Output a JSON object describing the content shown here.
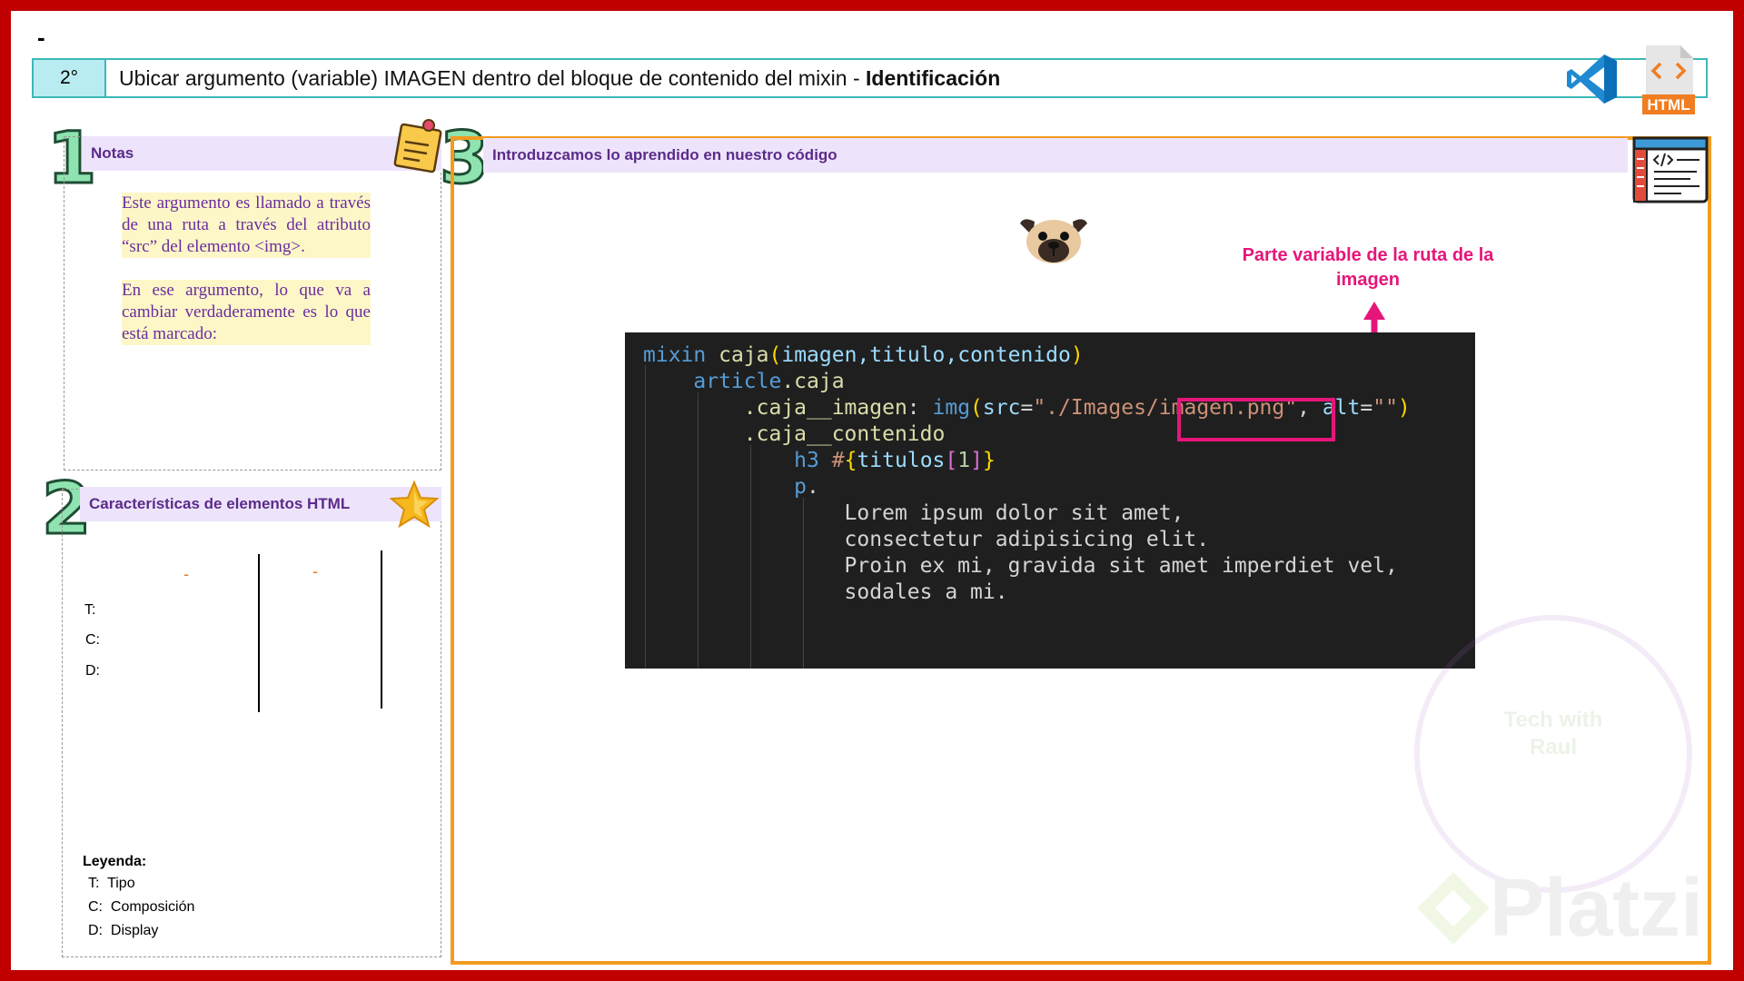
{
  "page": {
    "dash": "-"
  },
  "header": {
    "number": "2°",
    "title_main": "Ubicar argumento (variable) IMAGEN dentro del bloque de contenido del mixin - ",
    "title_bold": "Identificación",
    "html_badge": "HTML"
  },
  "section_numbers": [
    "1",
    "2",
    "3"
  ],
  "notes": {
    "heading": "Notas",
    "paragraph1": "Este argumento es llamado a través de una ruta a través del atributo “src” del elemento <img>.",
    "paragraph2": "En ese argumento, lo que va a cambiar verdaderamente es lo que está marcado:"
  },
  "characteristics": {
    "heading": "Características de elementos HTML",
    "dash1": "-",
    "dash2": "-",
    "row_labels": [
      "T:",
      "C:",
      "D:"
    ],
    "legend_title": "Leyenda:",
    "legend": [
      {
        "key": "T:",
        "value": "Tipo"
      },
      {
        "key": "C:",
        "value": "Composición"
      },
      {
        "key": "D:",
        "value": "Display"
      }
    ]
  },
  "code_panel": {
    "heading": "Introduzcamos lo aprendido en nuestro código",
    "annotation": "Parte variable de la ruta de la imagen",
    "lines": [
      "mixin caja(imagen,titulo,contenido)",
      "    article.caja",
      "        .caja__imagen: img(src=\"./Images/imagen.png\", alt=\"\")",
      "        .caja__contenido",
      "            h3 #{titulos[1]}",
      "            p.",
      "                Lorem ipsum dolor sit amet,",
      "                consectetur adipisicing elit.",
      "                Proin ex mi, gravida sit amet imperdiet vel,",
      "                sodales a mi."
    ]
  },
  "watermark": {
    "text1": "Tech with",
    "text2": "Raul",
    "brand": "Platzi"
  },
  "colors": {
    "frame": "#c00000",
    "header_border": "#3cb8b8",
    "panel_heading_bg": "#ede4fb",
    "panel_heading_text": "#5b2b8a",
    "code_panel_border": "#f29b1e",
    "annotation": "#e5167a"
  },
  "icons": [
    "vscode-icon",
    "html-file-icon",
    "sticky-note-icon",
    "star-icon",
    "code-window-icon",
    "pug-icon",
    "arrow-up-icon"
  ]
}
